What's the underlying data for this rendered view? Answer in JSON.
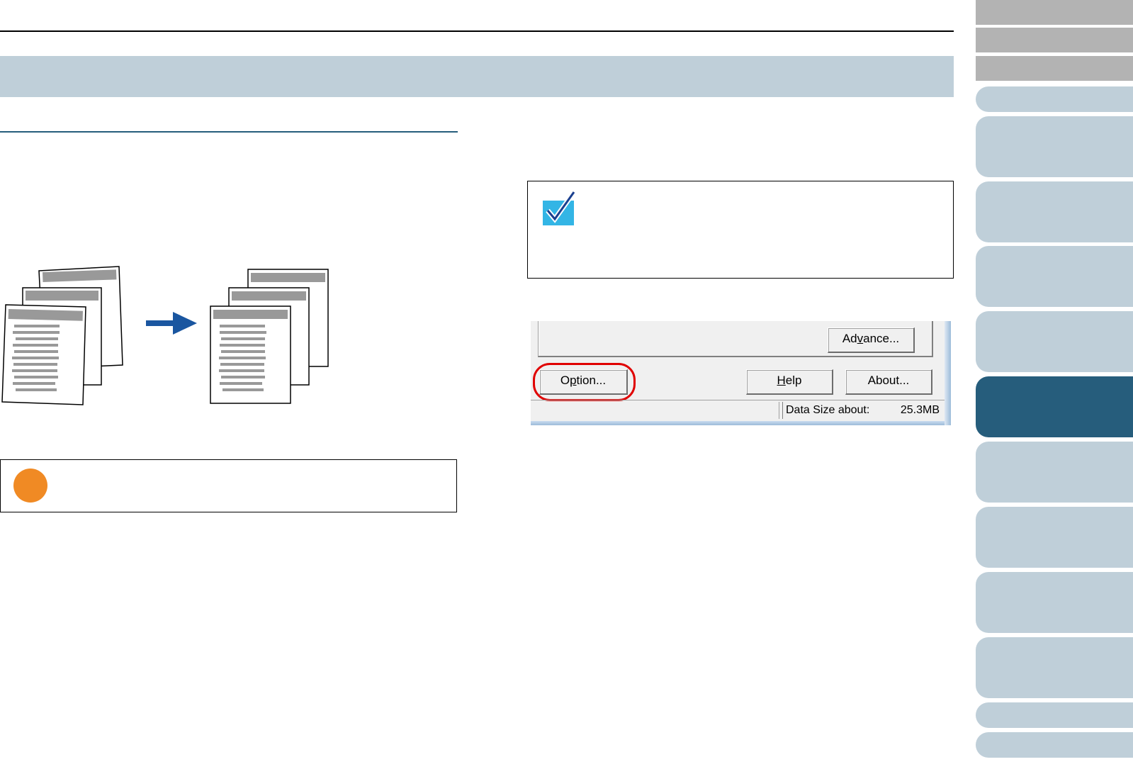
{
  "dialog": {
    "advance_label_pre": "Ad",
    "advance_label_ul": "v",
    "advance_label_post": "ance...",
    "option_label_pre": "O",
    "option_label_ul": "p",
    "option_label_post": "tion...",
    "help_label_ul": "H",
    "help_label_post": "elp",
    "about_label": "About...",
    "data_size_label": "Data Size about:",
    "data_size_value": "25.3MB"
  },
  "colors": {
    "header_band": "#bfcfd9",
    "sidebar_active": "#265d7c",
    "highlight_ring": "#e00000",
    "arrow": "#1a56a0",
    "caution": "#f08a24",
    "hint_check": "#33b5e5"
  }
}
